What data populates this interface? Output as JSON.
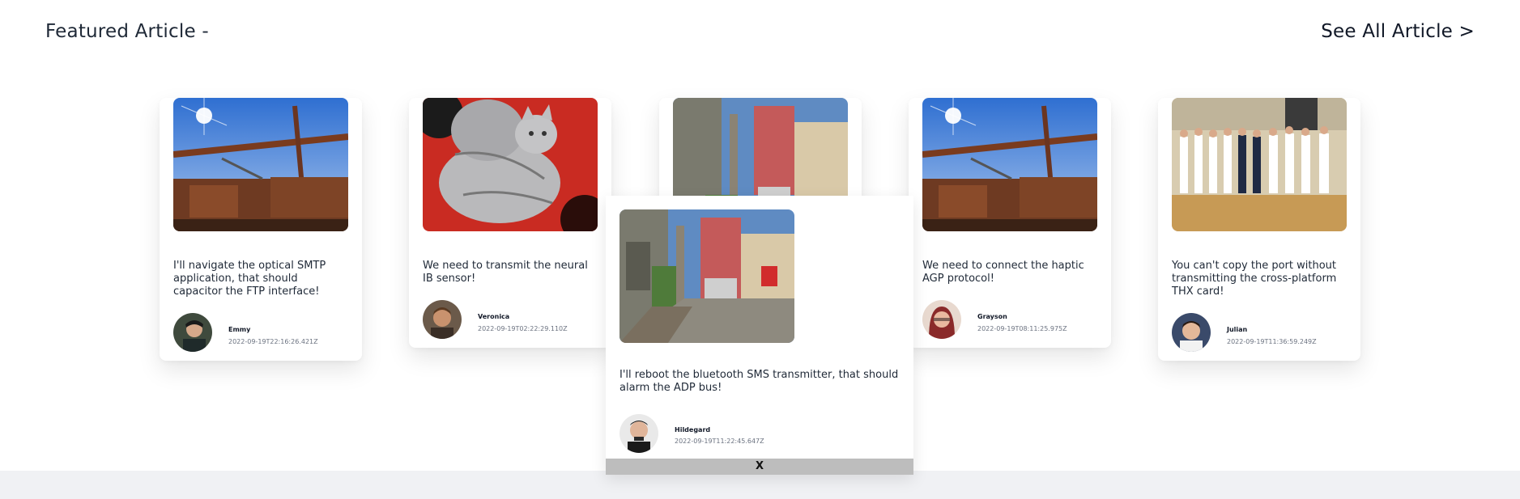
{
  "header": {
    "title": "Featured Article -",
    "see_all": "See All Article >"
  },
  "articles": [
    {
      "title": "I'll navigate the optical SMTP application, that should capacitor the FTP interface!",
      "author": "Emmy",
      "date": "2022-09-19T22:16:26.421Z",
      "image": "industrial-sky-photo"
    },
    {
      "title": "We need to transmit the neural IB sensor!",
      "author": "Veronica",
      "date": "2022-09-19T02:22:29.110Z",
      "image": "kitten-photo"
    },
    {
      "title": "I'll reboot the bluetooth SMS transmitter, that should alarm the ADP bus!",
      "author": "Hildegard",
      "date": "2022-09-19T11:22:45.647Z",
      "image": "street-photo"
    },
    {
      "title": "We need to connect the haptic AGP protocol!",
      "author": "Grayson",
      "date": "2022-09-19T08:11:25.975Z",
      "image": "industrial-sky-photo"
    },
    {
      "title": "You can't copy the port without transmitting the cross-platform THX card!",
      "author": "Julian",
      "date": "2022-09-19T11:36:59.249Z",
      "image": "volleyball-team-photo"
    }
  ],
  "popup": {
    "close_label": "X"
  },
  "colors": {
    "background": "#ffffff",
    "bottom_band": "#f0f1f4",
    "close_bar": "#bdbdbd"
  }
}
